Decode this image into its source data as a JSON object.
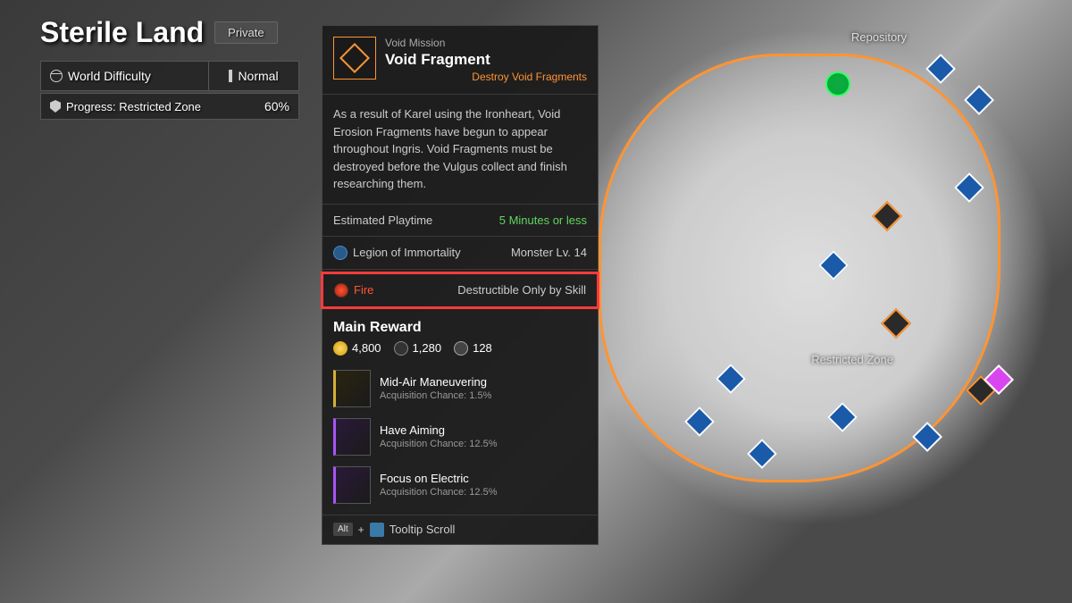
{
  "header": {
    "title": "Sterile Land",
    "privacy": "Private"
  },
  "stats": {
    "difficulty_label": "World Difficulty",
    "difficulty_value": "Normal",
    "progress_label": "Progress: Restricted Zone",
    "progress_value": "60%"
  },
  "panel": {
    "category": "Void Mission",
    "title": "Void Fragment",
    "subtitle": "Destroy Void Fragments",
    "description": "As a result of Karel using the Ironheart, Void Erosion Fragments have begun to appear throughout Ingris. Void Fragments must be destroyed before the Vulgus collect and finish researching them.",
    "playtime_label": "Estimated Playtime",
    "playtime_value": "5 Minutes or less",
    "faction": "Legion of Immortality",
    "monster_level": "Monster Lv. 14",
    "element": "Fire",
    "element_note": "Destructible Only by Skill",
    "reward_header": "Main Reward",
    "currencies": [
      {
        "k": "gold",
        "v": "4,800"
      },
      {
        "k": "xp",
        "v": "1,280"
      },
      {
        "k": "gear",
        "v": "128"
      }
    ],
    "rewards": [
      {
        "name": "Mid-Air Maneuvering",
        "chance": "Acquisition Chance: 1.5%",
        "tier": "gold"
      },
      {
        "name": "Have Aiming",
        "chance": "Acquisition Chance: 12.5%",
        "tier": "purple"
      },
      {
        "name": "Focus on Electric",
        "chance": "Acquisition Chance: 12.5%",
        "tier": "purple"
      }
    ],
    "footer": {
      "key": "Alt",
      "text": "Tooltip Scroll"
    }
  },
  "map": {
    "labels": [
      {
        "t": "Repository"
      },
      {
        "t": "Restricted Zone"
      }
    ]
  }
}
